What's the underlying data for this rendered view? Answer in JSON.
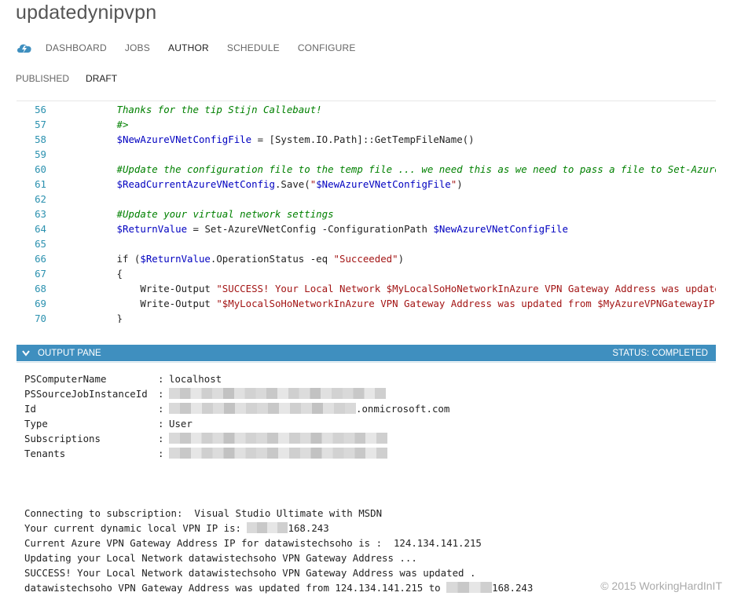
{
  "page": {
    "title": "updatedynipvpn"
  },
  "nav": {
    "icon": "cloud-lightning-icon",
    "items": [
      "DASHBOARD",
      "JOBS",
      "AUTHOR",
      "SCHEDULE",
      "CONFIGURE"
    ],
    "active": "AUTHOR"
  },
  "subnav": {
    "items": [
      "PUBLISHED",
      "DRAFT"
    ],
    "active": "DRAFT"
  },
  "editor": {
    "lines": [
      {
        "num": "56",
        "parts": [
          {
            "t": "com",
            "s": "            Thanks for the tip Stijn Callebaut!"
          }
        ]
      },
      {
        "num": "57",
        "parts": [
          {
            "t": "com",
            "s": "            #>"
          }
        ]
      },
      {
        "num": "58",
        "parts": [
          {
            "t": "txt",
            "s": "            "
          },
          {
            "t": "var",
            "s": "$NewAzureVNetConfigFile"
          },
          {
            "t": "txt",
            "s": " = [System.IO.Path]::GetTempFileName()"
          }
        ]
      },
      {
        "num": "59",
        "parts": [
          {
            "t": "txt",
            "s": ""
          }
        ]
      },
      {
        "num": "60",
        "parts": [
          {
            "t": "com",
            "s": "            #Update the configuration file to the temp file ... we need this as we need to pass a file to Set-AzureVNetConfig"
          }
        ]
      },
      {
        "num": "61",
        "parts": [
          {
            "t": "txt",
            "s": "            "
          },
          {
            "t": "var",
            "s": "$ReadCurrentAzureVNetConfig"
          },
          {
            "t": "txt",
            "s": ".Save("
          },
          {
            "t": "str",
            "s": "\""
          },
          {
            "t": "var",
            "s": "$NewAzureVNetConfigFile"
          },
          {
            "t": "str",
            "s": "\""
          },
          {
            "t": "txt",
            "s": ")"
          }
        ]
      },
      {
        "num": "62",
        "parts": [
          {
            "t": "txt",
            "s": ""
          }
        ]
      },
      {
        "num": "63",
        "parts": [
          {
            "t": "com",
            "s": "            #Update your virtual network settings"
          }
        ]
      },
      {
        "num": "64",
        "parts": [
          {
            "t": "txt",
            "s": "            "
          },
          {
            "t": "var",
            "s": "$ReturnValue"
          },
          {
            "t": "txt",
            "s": " = Set-AzureVNetConfig -ConfigurationPath "
          },
          {
            "t": "var",
            "s": "$NewAzureVNetConfigFile"
          }
        ]
      },
      {
        "num": "65",
        "parts": [
          {
            "t": "txt",
            "s": ""
          }
        ]
      },
      {
        "num": "66",
        "parts": [
          {
            "t": "txt",
            "s": "            if ("
          },
          {
            "t": "var",
            "s": "$ReturnValue"
          },
          {
            "t": "txt",
            "s": ".OperationStatus -eq "
          },
          {
            "t": "str",
            "s": "\"Succeeded\""
          },
          {
            "t": "txt",
            "s": ")"
          }
        ]
      },
      {
        "num": "67",
        "parts": [
          {
            "t": "txt",
            "s": "            {"
          }
        ]
      },
      {
        "num": "68",
        "parts": [
          {
            "t": "txt",
            "s": "                Write-Output "
          },
          {
            "t": "str",
            "s": "\"SUCCESS! Your Local Network $MyLocalSoHoNetworkInAzure VPN Gateway Address was updated .\""
          }
        ]
      },
      {
        "num": "69",
        "parts": [
          {
            "t": "txt",
            "s": "                Write-Output "
          },
          {
            "t": "str",
            "s": "\"$MyLocalSoHoNetworkInAzure VPN Gateway Address was updated from $MyAzureVPNGatewayIP\""
          }
        ]
      },
      {
        "num": "70",
        "parts": [
          {
            "t": "txt",
            "s": "            }"
          }
        ]
      }
    ]
  },
  "output": {
    "pane_label": "OUTPUT PANE",
    "status": "STATUS: COMPLETED",
    "props": [
      {
        "key": "PSComputerName",
        "value": "localhost",
        "redacted": false,
        "suffix": ""
      },
      {
        "key": "PSSourceJobInstanceId",
        "value": "",
        "redacted": true,
        "suffix": ""
      },
      {
        "key": "Id",
        "value": "",
        "redacted": true,
        "suffix": ".onmicrosoft.com"
      },
      {
        "key": "Type",
        "value": "User",
        "redacted": false,
        "suffix": ""
      },
      {
        "key": "Subscriptions",
        "value": "",
        "redacted": true,
        "suffix": ""
      },
      {
        "key": "Tenants",
        "value": "",
        "redacted": true,
        "suffix": ""
      }
    ],
    "log": [
      {
        "pre": "Connecting to subscription:  Visual Studio Ultimate with MSDN",
        "redacted": false,
        "post": ""
      },
      {
        "pre": "Your current dynamic local VPN IP is: ",
        "redacted": true,
        "post": "168.243"
      },
      {
        "pre": "Current Azure VPN Gateway Address IP for datawistechsoho is :  124.134.141.215",
        "redacted": false,
        "post": ""
      },
      {
        "pre": "Updating your Local Network datawistechsoho VPN Gateway Address ...",
        "redacted": false,
        "post": ""
      },
      {
        "pre": "SUCCESS! Your Local Network datawistechsoho VPN Gateway Address was updated .",
        "redacted": false,
        "post": ""
      },
      {
        "pre": "datawistechsoho VPN Gateway Address was updated from 124.134.141.215 to ",
        "redacted": true,
        "post": "168.243"
      }
    ]
  },
  "footer": {
    "copyright": "© 2015 WorkingHardInIT"
  },
  "colors": {
    "accent_bar": "#3f8fbf",
    "line_numbers": "#2b91af",
    "comment": "#008000",
    "variable": "#0000c0",
    "string": "#a31515"
  }
}
